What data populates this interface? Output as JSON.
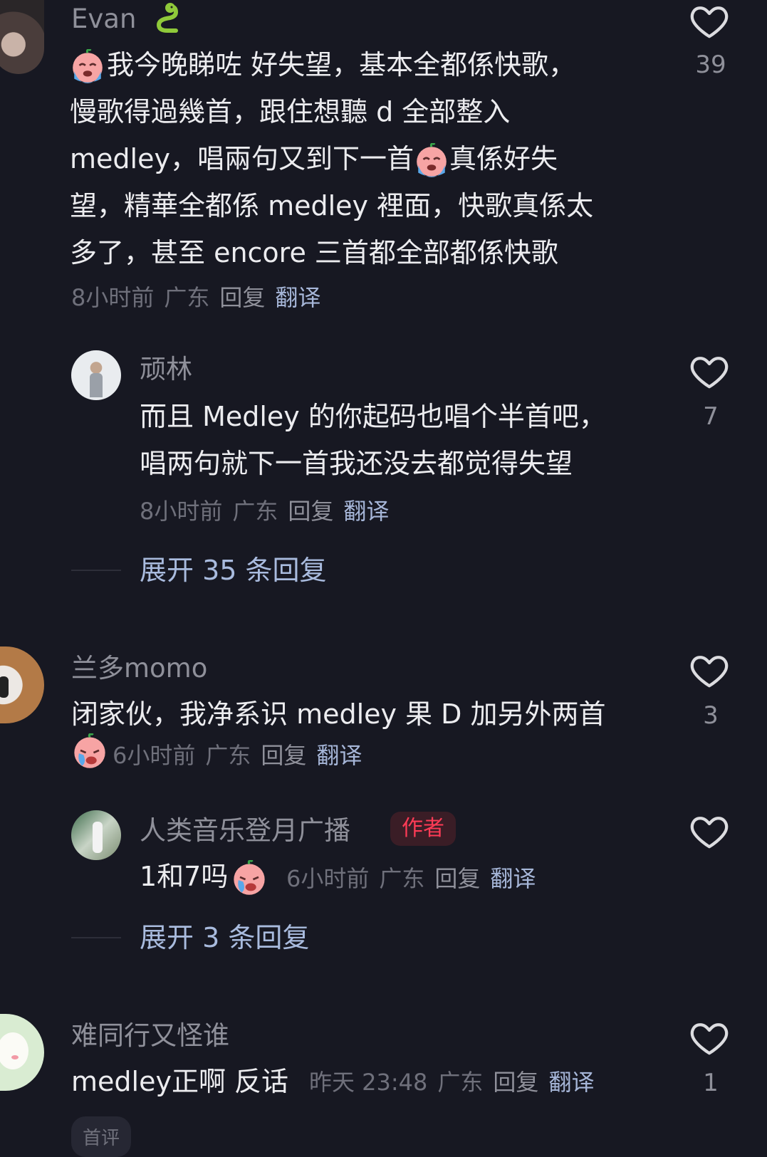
{
  "comments": [
    {
      "name": "Evan",
      "lines": [
        "我今晚睇咗 好失望，基本全都係快歌，",
        "慢歌得過幾首，跟住想聽 d 全部整入",
        " medley，唱兩句又到下一首",
        "望，精華全都係 medley 裡面，快歌真係太",
        "多了，甚至 encore 三首都全部都係快歌"
      ],
      "line3_tail": "真係好失",
      "time": "8小时前",
      "location": "广东",
      "reply": "回复",
      "translate": "翻译",
      "likes": "39"
    },
    {
      "name": "顽林",
      "lines": [
        "而且 Medley 的你起码也唱个半首吧，",
        "唱两句就下一首我还没去都觉得失望"
      ],
      "time": "8小时前",
      "location": "广东",
      "reply": "回复",
      "translate": "翻译",
      "likes": "7",
      "expand": "展开 35 条回复"
    },
    {
      "name": "兰多momo",
      "lines": [
        "闭家伙，我净系识 medley 果 D 加另外两首"
      ],
      "time": "6小时前",
      "location": "广东",
      "reply": "回复",
      "translate": "翻译",
      "likes": "3"
    },
    {
      "name": "人类音乐登月广播",
      "badge": "作者",
      "text": "1和7吗",
      "time": "6小时前",
      "location": "广东",
      "reply": "回复",
      "translate": "翻译",
      "expand": "展开 3 条回复"
    },
    {
      "name": "难同行又怪谁",
      "text": "medley正啊 反话",
      "time": "昨天 23:48",
      "location": "广东",
      "reply": "回复",
      "translate": "翻译",
      "likes": "1"
    }
  ],
  "bottom_pill": "首评",
  "colors": {
    "background": "#171822",
    "name": "#8f909a",
    "link": "#a9bbde",
    "author_badge": "#ff3b56"
  },
  "icons": [
    "heart-outline-icon",
    "cry-emoji-icon",
    "tearful-emoji-icon",
    "snake-emoji-icon"
  ]
}
